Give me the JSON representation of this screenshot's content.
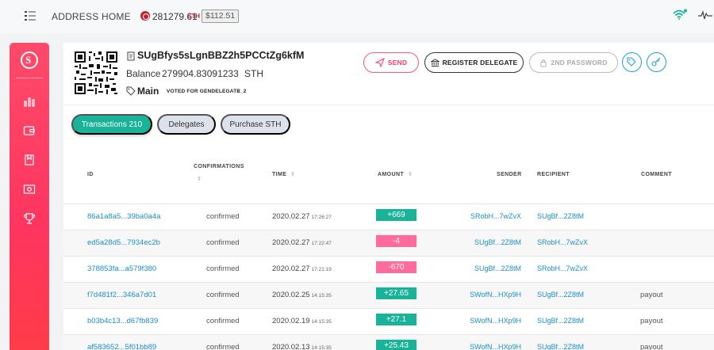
{
  "topbar": {
    "nav": [
      "ADDRESS",
      "HOME"
    ],
    "price": "281279.61",
    "price_unit": "STH",
    "price_usd": "$112.51"
  },
  "wallet": {
    "address": "SUgBfys5sLgnBBZ2h5PCCtZg6kfM",
    "balance_label": "Balance",
    "balance": "279904.83091233",
    "balance_unit": "STH",
    "name": "Main",
    "voted_for": "VOTED FOR GENDELEGATE_2",
    "voted_close": "×"
  },
  "actions": {
    "send": "SEND",
    "register_delegate": "REGISTER DELEGATE",
    "second_password": "2ND PASSWORD"
  },
  "tabs": [
    "Transactions 210",
    "Delegates",
    "Purchase STH"
  ],
  "columns": {
    "id": "ID",
    "confirmations": "CONFIRMATIONS",
    "time": "TIME",
    "amount": "AMOUNT",
    "sender": "SENDER",
    "recipient": "RECIPIENT",
    "comment": "COMMENT"
  },
  "colors": {
    "brand": "#ff3c5c",
    "positive": "#19b399",
    "negative": "#ff6b9a",
    "link": "#1a8fd0"
  },
  "transactions": [
    {
      "id": "86a1a8a5...39ba0a4a",
      "confirmations": "confirmed",
      "date": "2020.02.27",
      "clock": "17:26:27",
      "amount": "+669",
      "positive": true,
      "sender": "SRobH...7wZvX",
      "recipient": "SUgBf...2Z8tM",
      "comment": ""
    },
    {
      "id": "ed5a28d5...7934ec2b",
      "confirmations": "confirmed",
      "date": "2020.02.27",
      "clock": "17:22:47",
      "amount": "-4",
      "positive": false,
      "sender": "SUgBf...2Z8tM",
      "recipient": "SRobH...7wZvX",
      "comment": ""
    },
    {
      "id": "378853fa...a579f380",
      "confirmations": "confirmed",
      "date": "2020.02.27",
      "clock": "17:21:19",
      "amount": "-670",
      "positive": false,
      "sender": "SUgBf...2Z8tM",
      "recipient": "SRobH...7wZvX",
      "comment": ""
    },
    {
      "id": "f7d481f2...346a7d01",
      "confirmations": "confirmed",
      "date": "2020.02.25",
      "clock": "14:15:35",
      "amount": "+27.65",
      "positive": true,
      "sender": "SWofN...HXp9H",
      "recipient": "SUgBf...2Z8tM",
      "comment": "payout"
    },
    {
      "id": "b03b4c13...d67fb839",
      "confirmations": "confirmed",
      "date": "2020.02.19",
      "clock": "14:15:35",
      "amount": "+27.1",
      "positive": true,
      "sender": "SWofN...HXp9H",
      "recipient": "SUgBf...2Z8tM",
      "comment": "payout"
    },
    {
      "id": "af583652...5f01bb89",
      "confirmations": "confirmed",
      "date": "2020.02.13",
      "clock": "14:15:35",
      "amount": "+25.43",
      "positive": true,
      "sender": "SWofN...HXp9H",
      "recipient": "SUgBf...2Z8tM",
      "comment": "payout"
    }
  ]
}
